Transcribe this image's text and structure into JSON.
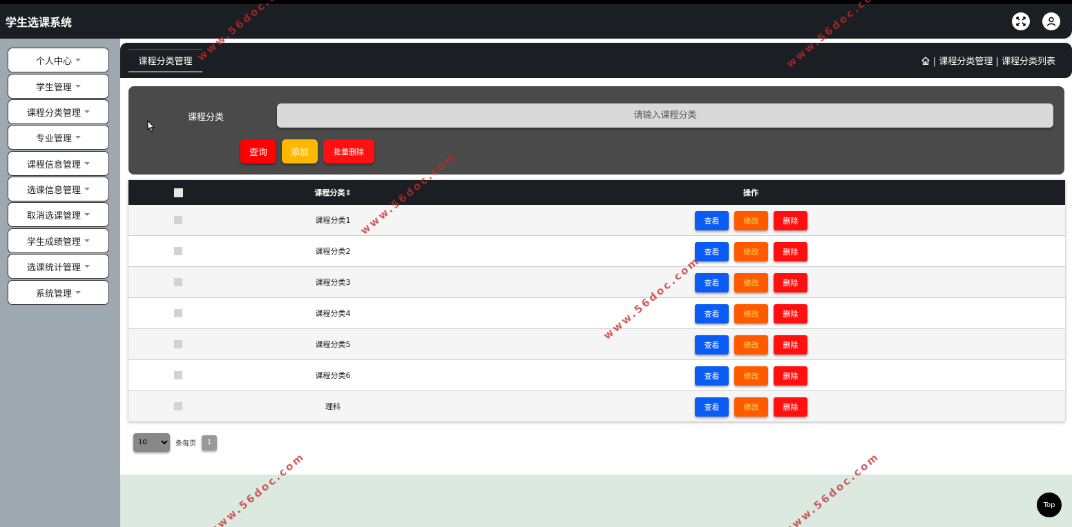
{
  "app": {
    "title": "学生选课系统"
  },
  "topbar": {
    "icons": [
      "fullscreen-icon",
      "user-icon"
    ]
  },
  "sidebar": {
    "items": [
      {
        "label": "个人中心"
      },
      {
        "label": "学生管理"
      },
      {
        "label": "课程分类管理"
      },
      {
        "label": "专业管理"
      },
      {
        "label": "课程信息管理"
      },
      {
        "label": "选课信息管理"
      },
      {
        "label": "取消选课管理"
      },
      {
        "label": "学生成绩管理"
      },
      {
        "label": "选课统计管理"
      },
      {
        "label": "系统管理"
      }
    ]
  },
  "tabs": {
    "active": "课程分类管理"
  },
  "breadcrumb": {
    "path": "| 课程分类管理 | 课程分类列表"
  },
  "search": {
    "label": "课程分类",
    "placeholder": "请输入课程分类",
    "query_label": "查询",
    "add_label": "添加",
    "batch_delete_label": "批量删除"
  },
  "table": {
    "headers": {
      "name": "课程分类",
      "sort_mark": "⇕",
      "actions": "操作"
    },
    "rows": [
      {
        "name": "课程分类1"
      },
      {
        "name": "课程分类2"
      },
      {
        "name": "课程分类3"
      },
      {
        "name": "课程分类4"
      },
      {
        "name": "课程分类5"
      },
      {
        "name": "课程分类6"
      },
      {
        "name": "理科"
      }
    ],
    "actions": {
      "view": "查看",
      "edit": "修改",
      "delete": "删除"
    }
  },
  "pager": {
    "page_size": "10",
    "per_page_label": "条每页",
    "current_page": "1"
  },
  "back_to_top": "Top",
  "watermark": "www.56doc.com",
  "colors": {
    "dark": "#1b1e22",
    "panel": "#4a4a4a",
    "sidebar": "#9ea8b1",
    "query": "#ff0000",
    "add": "#ffb800",
    "batch_delete": "#ff1010",
    "view": "#0a5cf5",
    "edit": "#ff5a00",
    "delete": "#ff1010"
  }
}
